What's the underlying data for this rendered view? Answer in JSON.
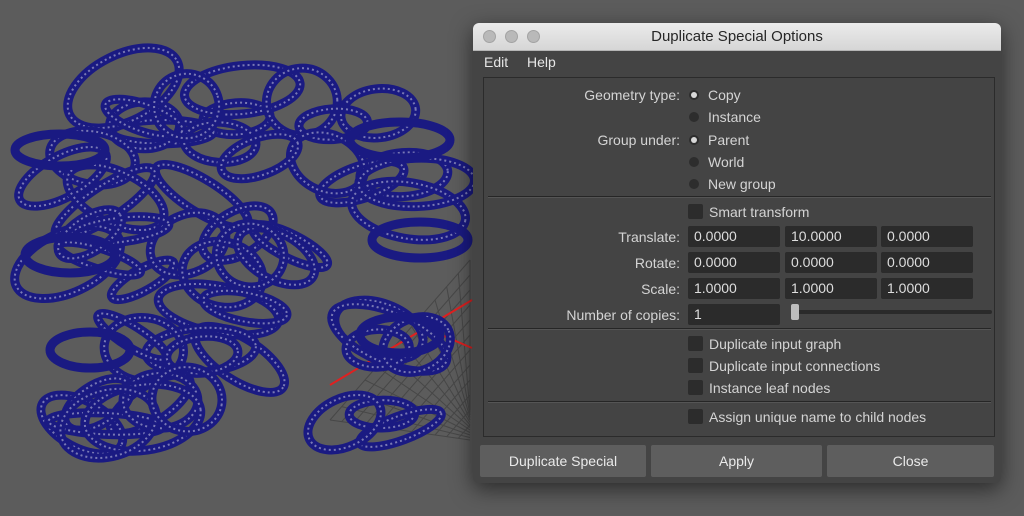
{
  "dialog": {
    "title": "Duplicate Special Options",
    "menu": {
      "edit": "Edit",
      "help": "Help"
    },
    "geometry_type": {
      "label": "Geometry type:",
      "options": [
        "Copy",
        "Instance"
      ],
      "selected": "Copy"
    },
    "group_under": {
      "label": "Group under:",
      "options": [
        "Parent",
        "World",
        "New group"
      ],
      "selected": "Parent"
    },
    "smart_transform": {
      "label": "Smart transform",
      "checked": false
    },
    "translate": {
      "label": "Translate:",
      "values": [
        "0.0000",
        "10.0000",
        "0.0000"
      ]
    },
    "rotate": {
      "label": "Rotate:",
      "values": [
        "0.0000",
        "0.0000",
        "0.0000"
      ]
    },
    "scale": {
      "label": "Scale:",
      "values": [
        "1.0000",
        "1.0000",
        "1.0000"
      ]
    },
    "copies": {
      "label": "Number of copies:",
      "value": "1"
    },
    "checkboxes": {
      "dup_graph": "Duplicate input graph",
      "dup_connections": "Duplicate input connections",
      "instance_leaf": "Instance leaf nodes",
      "assign_unique": "Assign unique name to child nodes"
    },
    "buttons": {
      "duplicate_special": "Duplicate Special",
      "apply": "Apply",
      "close": "Close"
    }
  },
  "colors": {
    "mesh": "#1a1a82",
    "axis": "#e02020",
    "dialog_bg": "#444444"
  }
}
